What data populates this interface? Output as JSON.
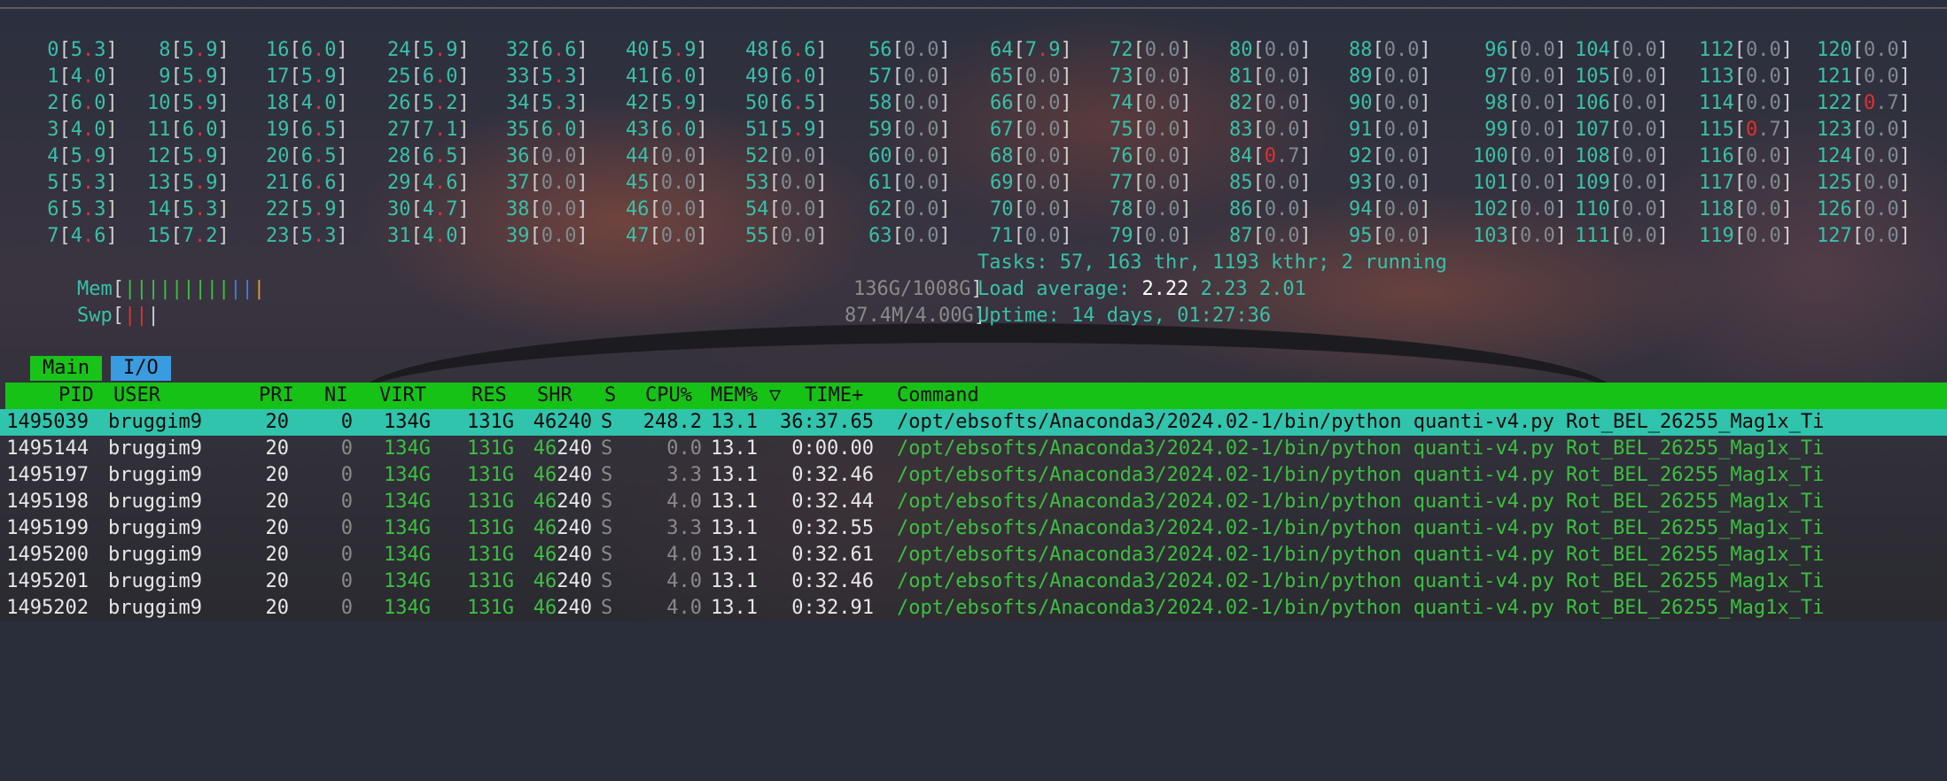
{
  "cpus": [
    [
      "0",
      "5.3"
    ],
    [
      "1",
      "4.0"
    ],
    [
      "2",
      "6.0"
    ],
    [
      "3",
      "4.0"
    ],
    [
      "4",
      "5.9"
    ],
    [
      "5",
      "5.3"
    ],
    [
      "6",
      "5.3"
    ],
    [
      "7",
      "4.6"
    ],
    [
      "8",
      "5.9"
    ],
    [
      "9",
      "5.9"
    ],
    [
      "10",
      "5.9"
    ],
    [
      "11",
      "6.0"
    ],
    [
      "12",
      "5.9"
    ],
    [
      "13",
      "5.9"
    ],
    [
      "14",
      "5.3"
    ],
    [
      "15",
      "7.2"
    ],
    [
      "16",
      "6.0"
    ],
    [
      "17",
      "5.9"
    ],
    [
      "18",
      "4.0"
    ],
    [
      "19",
      "6.5"
    ],
    [
      "20",
      "6.5"
    ],
    [
      "21",
      "6.6"
    ],
    [
      "22",
      "5.9"
    ],
    [
      "23",
      "5.3"
    ],
    [
      "24",
      "5.9"
    ],
    [
      "25",
      "6.0"
    ],
    [
      "26",
      "5.2"
    ],
    [
      "27",
      "7.1"
    ],
    [
      "28",
      "6.5"
    ],
    [
      "29",
      "4.6"
    ],
    [
      "30",
      "4.7"
    ],
    [
      "31",
      "4.0"
    ],
    [
      "32",
      "6.6"
    ],
    [
      "33",
      "5.3"
    ],
    [
      "34",
      "5.3"
    ],
    [
      "35",
      "6.0"
    ],
    [
      "36",
      "0.0"
    ],
    [
      "37",
      "0.0"
    ],
    [
      "38",
      "0.0"
    ],
    [
      "39",
      "0.0"
    ],
    [
      "40",
      "5.9"
    ],
    [
      "41",
      "6.0"
    ],
    [
      "42",
      "5.9"
    ],
    [
      "43",
      "6.0"
    ],
    [
      "44",
      "0.0"
    ],
    [
      "45",
      "0.0"
    ],
    [
      "46",
      "0.0"
    ],
    [
      "47",
      "0.0"
    ],
    [
      "48",
      "6.6"
    ],
    [
      "49",
      "6.0"
    ],
    [
      "50",
      "6.5"
    ],
    [
      "51",
      "5.9"
    ],
    [
      "52",
      "0.0"
    ],
    [
      "53",
      "0.0"
    ],
    [
      "54",
      "0.0"
    ],
    [
      "55",
      "0.0"
    ],
    [
      "56",
      "0.0"
    ],
    [
      "57",
      "0.0"
    ],
    [
      "58",
      "0.0"
    ],
    [
      "59",
      "0.0"
    ],
    [
      "60",
      "0.0"
    ],
    [
      "61",
      "0.0"
    ],
    [
      "62",
      "0.0"
    ],
    [
      "63",
      "0.0"
    ],
    [
      "64",
      "7.9"
    ],
    [
      "65",
      "0.0"
    ],
    [
      "66",
      "0.0"
    ],
    [
      "67",
      "0.0"
    ],
    [
      "68",
      "0.0"
    ],
    [
      "69",
      "0.0"
    ],
    [
      "70",
      "0.0"
    ],
    [
      "71",
      "0.0"
    ],
    [
      "72",
      "0.0"
    ],
    [
      "73",
      "0.0"
    ],
    [
      "74",
      "0.0"
    ],
    [
      "75",
      "0.0"
    ],
    [
      "76",
      "0.0"
    ],
    [
      "77",
      "0.0"
    ],
    [
      "78",
      "0.0"
    ],
    [
      "79",
      "0.0"
    ],
    [
      "80",
      "0.0"
    ],
    [
      "81",
      "0.0"
    ],
    [
      "82",
      "0.0"
    ],
    [
      "83",
      "0.0"
    ],
    [
      "84",
      "0.7"
    ],
    [
      "85",
      "0.0"
    ],
    [
      "86",
      "0.0"
    ],
    [
      "87",
      "0.0"
    ],
    [
      "88",
      "0.0"
    ],
    [
      "89",
      "0.0"
    ],
    [
      "90",
      "0.0"
    ],
    [
      "91",
      "0.0"
    ],
    [
      "92",
      "0.0"
    ],
    [
      "93",
      "0.0"
    ],
    [
      "94",
      "0.0"
    ],
    [
      "95",
      "0.0"
    ],
    [
      "96",
      "0.0"
    ],
    [
      "97",
      "0.0"
    ],
    [
      "98",
      "0.0"
    ],
    [
      "99",
      "0.0"
    ],
    [
      "100",
      "0.0"
    ],
    [
      "101",
      "0.0"
    ],
    [
      "102",
      "0.0"
    ],
    [
      "103",
      "0.0"
    ],
    [
      "104",
      "0.0"
    ],
    [
      "105",
      "0.0"
    ],
    [
      "106",
      "0.0"
    ],
    [
      "107",
      "0.0"
    ],
    [
      "108",
      "0.0"
    ],
    [
      "109",
      "0.0"
    ],
    [
      "110",
      "0.0"
    ],
    [
      "111",
      "0.0"
    ],
    [
      "112",
      "0.0"
    ],
    [
      "113",
      "0.0"
    ],
    [
      "114",
      "0.0"
    ],
    [
      "115",
      "0.7"
    ],
    [
      "116",
      "0.0"
    ],
    [
      "117",
      "0.0"
    ],
    [
      "118",
      "0.0"
    ],
    [
      "119",
      "0.0"
    ],
    [
      "120",
      "0.0"
    ],
    [
      "121",
      "0.0"
    ],
    [
      "122",
      "0.7"
    ],
    [
      "123",
      "0.0"
    ],
    [
      "124",
      "0.0"
    ],
    [
      "125",
      "0.0"
    ],
    [
      "126",
      "0.0"
    ],
    [
      "127",
      "0.0"
    ]
  ],
  "meters": {
    "mem": {
      "label": "Mem",
      "bars": "||||||||||||",
      "value": "136G/1008G"
    },
    "swp": {
      "label": "Swp",
      "bars": "|||",
      "value": "87.4M/4.00G"
    }
  },
  "info": {
    "tasks_label": "Tasks: ",
    "tasks": "57",
    "thr": "163",
    "thr_label": " thr, ",
    "kthr": "1193",
    "kthr_label": " kthr; ",
    "running": "2",
    "running_label": " running",
    "load_label": "Load average: ",
    "load1": "2.22",
    "load5": "2.23",
    "load15": "2.01",
    "uptime_label": "Uptime: ",
    "uptime": "14 days, 01:27:36"
  },
  "tabs": {
    "main": "Main",
    "io": "I/O"
  },
  "columns": {
    "pid": "PID",
    "user": "USER",
    "pri": "PRI",
    "ni": "NI",
    "virt": "VIRT",
    "res": "RES",
    "shr": "SHR",
    "s": "S",
    "cpu": "CPU%",
    "mem": "MEM%",
    "sort_icon": "▽",
    "time": "TIME+",
    "cmd": "Command"
  },
  "processes": [
    {
      "pid": "1495039",
      "user": "bruggim9",
      "pri": "20",
      "ni": "0",
      "virt": "134G",
      "res": "131G",
      "shr": "46240",
      "s": "S",
      "cpu": "248.2",
      "mem": "13.1",
      "time": "36:37.65",
      "cmd": "/opt/ebsofts/Anaconda3/2024.02-1/bin/python quanti-v4.py Rot_BEL_26255_Mag1x_Ti"
    },
    {
      "pid": "1495144",
      "user": "bruggim9",
      "pri": "20",
      "ni": "0",
      "virt": "134G",
      "res": "131G",
      "shr": "46240",
      "s": "S",
      "cpu": "0.0",
      "mem": "13.1",
      "time": "0:00.00",
      "cmd": "/opt/ebsofts/Anaconda3/2024.02-1/bin/python quanti-v4.py Rot_BEL_26255_Mag1x_Ti"
    },
    {
      "pid": "1495197",
      "user": "bruggim9",
      "pri": "20",
      "ni": "0",
      "virt": "134G",
      "res": "131G",
      "shr": "46240",
      "s": "S",
      "cpu": "3.3",
      "mem": "13.1",
      "time": "0:32.46",
      "cmd": "/opt/ebsofts/Anaconda3/2024.02-1/bin/python quanti-v4.py Rot_BEL_26255_Mag1x_Ti"
    },
    {
      "pid": "1495198",
      "user": "bruggim9",
      "pri": "20",
      "ni": "0",
      "virt": "134G",
      "res": "131G",
      "shr": "46240",
      "s": "S",
      "cpu": "4.0",
      "mem": "13.1",
      "time": "0:32.44",
      "cmd": "/opt/ebsofts/Anaconda3/2024.02-1/bin/python quanti-v4.py Rot_BEL_26255_Mag1x_Ti"
    },
    {
      "pid": "1495199",
      "user": "bruggim9",
      "pri": "20",
      "ni": "0",
      "virt": "134G",
      "res": "131G",
      "shr": "46240",
      "s": "S",
      "cpu": "3.3",
      "mem": "13.1",
      "time": "0:32.55",
      "cmd": "/opt/ebsofts/Anaconda3/2024.02-1/bin/python quanti-v4.py Rot_BEL_26255_Mag1x_Ti"
    },
    {
      "pid": "1495200",
      "user": "bruggim9",
      "pri": "20",
      "ni": "0",
      "virt": "134G",
      "res": "131G",
      "shr": "46240",
      "s": "S",
      "cpu": "4.0",
      "mem": "13.1",
      "time": "0:32.61",
      "cmd": "/opt/ebsofts/Anaconda3/2024.02-1/bin/python quanti-v4.py Rot_BEL_26255_Mag1x_Ti"
    },
    {
      "pid": "1495201",
      "user": "bruggim9",
      "pri": "20",
      "ni": "0",
      "virt": "134G",
      "res": "131G",
      "shr": "46240",
      "s": "S",
      "cpu": "4.0",
      "mem": "13.1",
      "time": "0:32.46",
      "cmd": "/opt/ebsofts/Anaconda3/2024.02-1/bin/python quanti-v4.py Rot_BEL_26255_Mag1x_Ti"
    },
    {
      "pid": "1495202",
      "user": "bruggim9",
      "pri": "20",
      "ni": "0",
      "virt": "134G",
      "res": "131G",
      "shr": "46240",
      "s": "S",
      "cpu": "4.0",
      "mem": "13.1",
      "time": "0:32.91",
      "cmd": "/opt/ebsofts/Anaconda3/2024.02-1/bin/python quanti-v4.py Rot_BEL_26255_Mag1x_Ti"
    }
  ]
}
